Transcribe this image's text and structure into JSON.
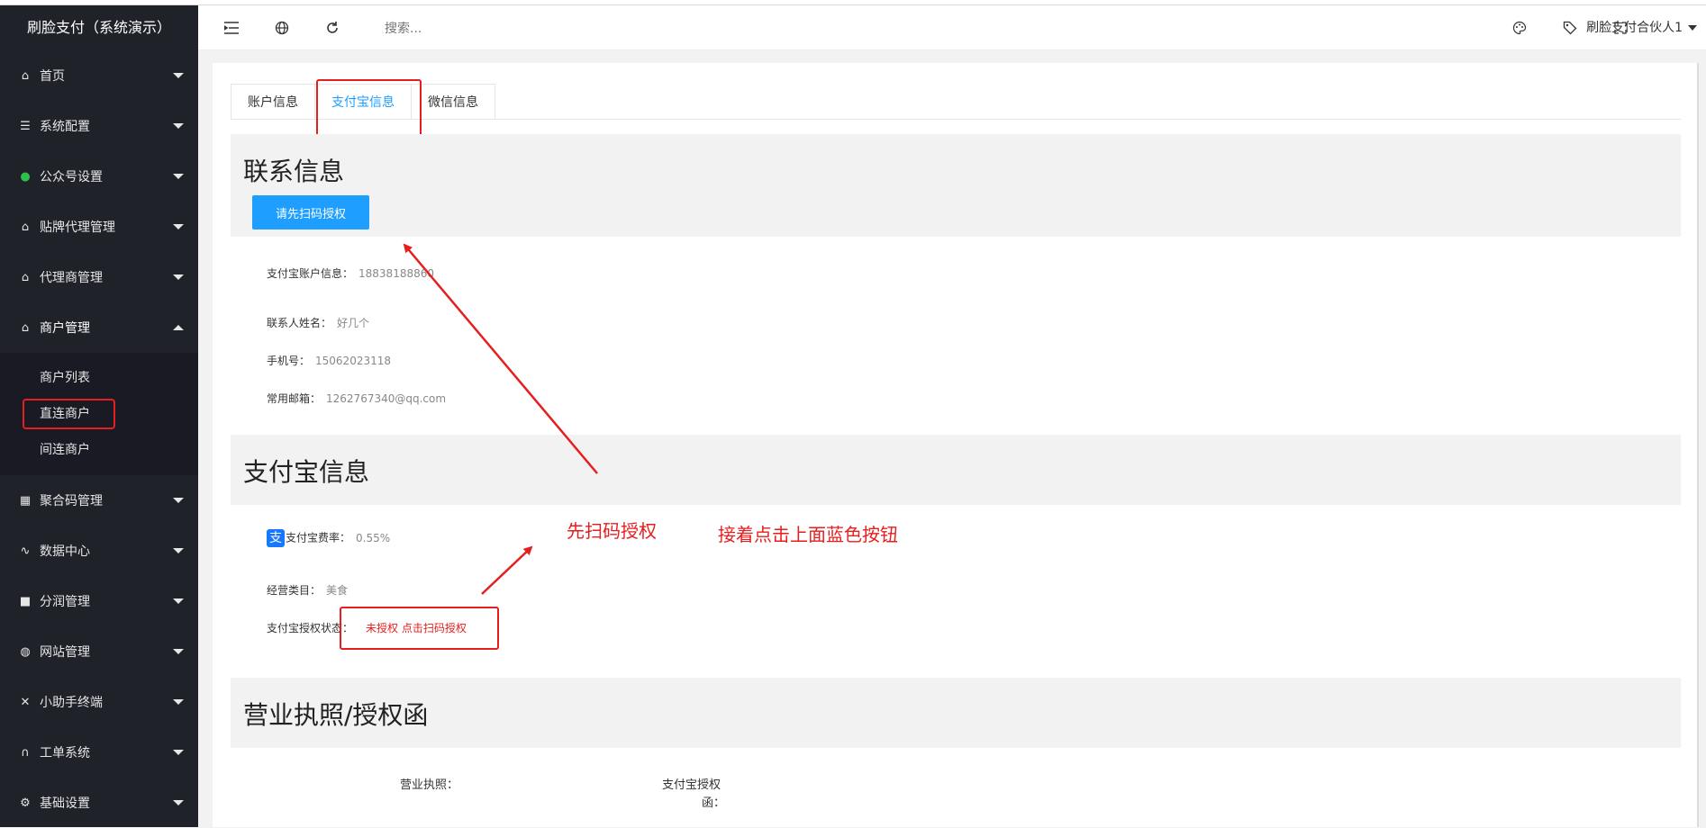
{
  "app": {
    "title": "刷脸支付（系统演示）"
  },
  "sidebar": {
    "items": [
      {
        "label": "首页",
        "icon": "home-icon"
      },
      {
        "label": "系统配置",
        "icon": "settings-list-icon"
      },
      {
        "label": "公众号设置",
        "icon": "wechat-icon"
      },
      {
        "label": "贴牌代理管理",
        "icon": "home-icon"
      },
      {
        "label": "代理商管理",
        "icon": "home-icon"
      },
      {
        "label": "商户管理",
        "icon": "home-icon"
      },
      {
        "label": "聚合码管理",
        "icon": "qrcode-icon"
      },
      {
        "label": "数据中心",
        "icon": "pulse-icon"
      },
      {
        "label": "分润管理",
        "icon": "comment-icon"
      },
      {
        "label": "网站管理",
        "icon": "globe-icon"
      },
      {
        "label": "小助手终端",
        "icon": "tools-icon"
      },
      {
        "label": "工单系统",
        "icon": "headset-icon"
      },
      {
        "label": "基础设置",
        "icon": "gear-icon"
      }
    ],
    "submenu": [
      "商户列表",
      "直连商户",
      "间连商户"
    ]
  },
  "header": {
    "search_placeholder": "搜索...",
    "user": "刷脸支付合伙人1"
  },
  "tabs": [
    "账户信息",
    "支付宝信息",
    "微信信息"
  ],
  "contact": {
    "title": "联系信息",
    "button": "请先扫码授权",
    "alipay_account_label": "支付宝账户信息：",
    "alipay_account_value": "18838188860",
    "name_label": "联系人姓名：",
    "name_value": "好几个",
    "phone_label": "手机号：",
    "phone_value": "15062023118",
    "email_label": "常用邮箱：",
    "email_value": "1262767340@qq.com"
  },
  "alipay": {
    "title": "支付宝信息",
    "badge": "支",
    "rate_label": "支付宝费率：",
    "rate_value": "0.55%",
    "category_label": "经营类目：",
    "category_value": "美食",
    "auth_label": "支付宝授权状态：",
    "auth_value": "未授权 点击扫码授权"
  },
  "license": {
    "title": "营业执照/授权函",
    "license_label": "营业执照：",
    "auth_letter_label_1": "支付宝授权",
    "auth_letter_label_2": "函："
  },
  "annotations": {
    "scan_first": "先扫码授权",
    "then_click": "接着点击上面蓝色按钮"
  },
  "colors": {
    "sidebar_bg": "#20222a",
    "accent_blue": "#1e9fff",
    "annotation_red": "#e61e1e"
  }
}
